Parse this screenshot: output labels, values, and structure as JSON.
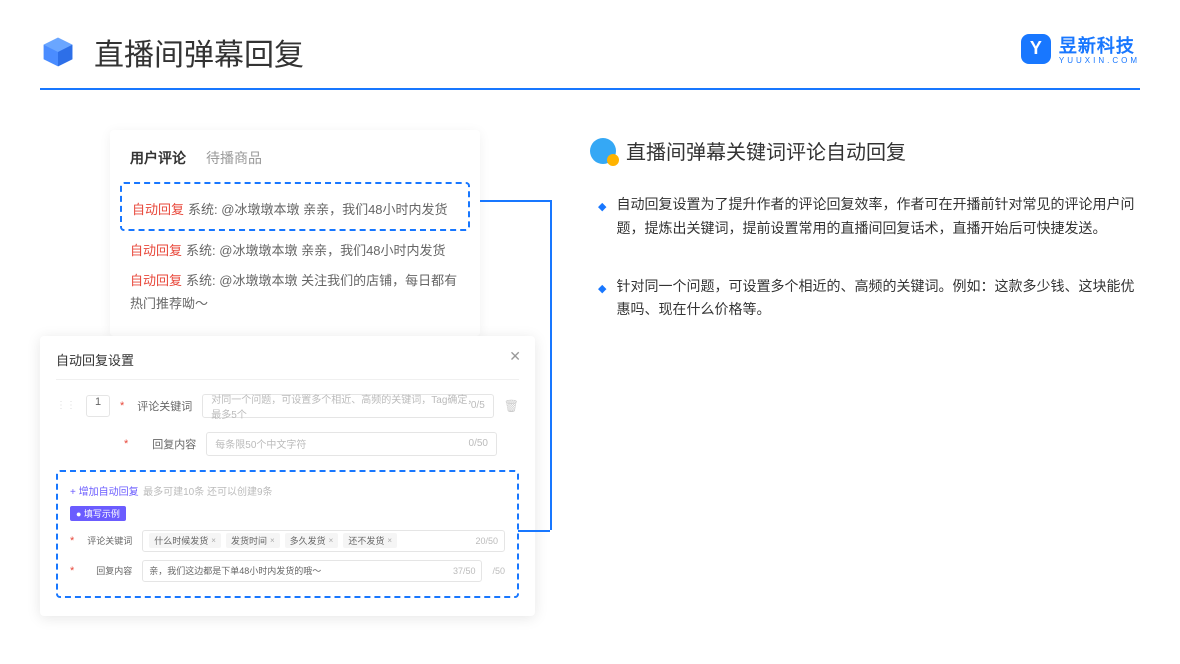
{
  "header": {
    "title": "直播间弹幕回复"
  },
  "logo": {
    "text": "昱新科技",
    "sub": "YUUXIN.COM",
    "mark": "Y"
  },
  "comments": {
    "tabs": {
      "active": "用户评论",
      "inactive": "待播商品"
    },
    "lines": [
      {
        "tag": "自动回复",
        "sys": "系统:",
        "body": "@冰墩墩本墩 亲亲，我们48小时内发货"
      },
      {
        "tag": "自动回复",
        "sys": "系统:",
        "body": "@冰墩墩本墩 亲亲，我们48小时内发货"
      },
      {
        "tag": "自动回复",
        "sys": "系统:",
        "body": "@冰墩墩本墩 关注我们的店铺，每日都有热门推荐呦～"
      }
    ]
  },
  "settings": {
    "title": "自动回复设置",
    "index": "1",
    "labels": {
      "keyword": "评论关键词",
      "reply": "回复内容"
    },
    "placeholders": {
      "keyword": "对同一个问题，可设置多个相近、高频的关键词，Tag确定，最多5个",
      "reply": "每条限50个中文字符"
    },
    "counts": {
      "keyword": "0/5",
      "reply": "0/50"
    },
    "add_link": "+ 增加自动回复",
    "add_hint": "最多可建10条 还可以创建9条",
    "example_badge": "● 填写示例",
    "example": {
      "tags": [
        "什么时候发货",
        "发货时间",
        "多久发货",
        "还不发货"
      ],
      "tag_count": "20/50",
      "reply_val": "亲，我们这边都是下单48小时内发货的哦～",
      "reply_count": "37/50",
      "outer_count": "/50"
    }
  },
  "right": {
    "title": "直播间弹幕关键词评论自动回复",
    "bullets": [
      "自动回复设置为了提升作者的评论回复效率，作者可在开播前针对常见的评论用户问题，提炼出关键词，提前设置常用的直播间回复话术，直播开始后可快捷发送。",
      "针对同一个问题，可设置多个相近的、高频的关键词。例如：这款多少钱、这块能优惠吗、现在什么价格等。"
    ]
  }
}
